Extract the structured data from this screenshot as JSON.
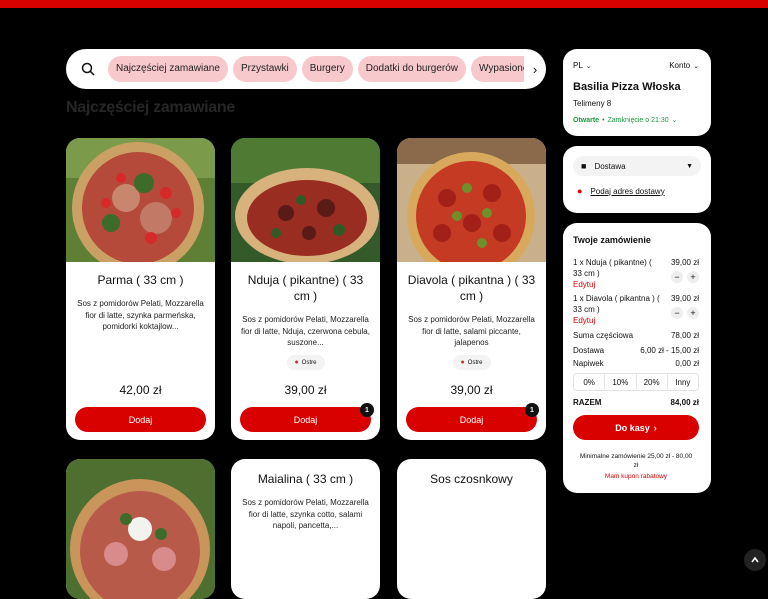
{
  "categories": {
    "items": [
      "Najczęściej zamawiane",
      "Przystawki",
      "Burgery",
      "Dodatki do burgerów",
      "Wypasione Frytki"
    ]
  },
  "section": {
    "title": "Najczęściej zamawiane"
  },
  "products": [
    {
      "name": "Parma ( 33 cm )",
      "desc": "Sos z pomidorów Pelati, Mozzarella fior di latte, szynka parmeńska, pomidorki koktajlow...",
      "price": "42,00 zł",
      "add": "Dodaj"
    },
    {
      "name": "Nduja ( pikantne) ( 33 cm )",
      "desc": "Sos z pomidorów Pelati, Mozzarella fior di latte, Nduja, czerwona cebula, suszone...",
      "badge": "Ostre",
      "price": "39,00 zł",
      "add": "Dodaj",
      "qty": "1"
    },
    {
      "name": "Diavola ( pikantna ) ( 33 cm )",
      "desc": "Sos z pomidorów Pelati, Mozzarella fior di latte, salami piccante, jalapenos",
      "badge": "Ostre",
      "price": "39,00 zł",
      "add": "Dodaj",
      "qty": "1"
    },
    {
      "name": "",
      "desc": ""
    },
    {
      "name": "Maialina ( 33 cm )",
      "desc": "Sos z pomidorów Pelati, Mozzarella fior di latte, szynka cotto, salami napoli, pancetta,..."
    },
    {
      "name": "Sos czosnkowy",
      "desc": ""
    }
  ],
  "restaurant": {
    "lang": "PL",
    "account": "Konto",
    "name": "Basilia Pizza Włoska",
    "address": "Telimeny 8",
    "open": "Otwarte",
    "close": "Zamknięcie o 21:30"
  },
  "delivery": {
    "mode": "Dostawa",
    "address_link": "Podaj adres dostawy"
  },
  "order": {
    "title": "Twoje zamówienie",
    "items": [
      {
        "name": "1 x Nduja ( pikantne) ( 33 cm )",
        "price": "39,00 zł",
        "edit": "Edytuj"
      },
      {
        "name": "1 x Diavola ( pikantna ) ( 33 cm )",
        "price": "39,00 zł",
        "edit": "Edytuj"
      }
    ],
    "subtotal_label": "Suma częściowa",
    "subtotal": "78,00 zł",
    "delivery_label": "Dostawa",
    "delivery": "6,00 zł - 15,00 zł",
    "tip_label": "Napiwek",
    "tip": "0,00 zł",
    "tips": [
      "0%",
      "10%",
      "20%",
      "Inny"
    ],
    "total_label": "RAZEM",
    "total": "84,00 zł",
    "checkout": "Do kasy",
    "minimum": "Minimalne zamówienie 25,00 zł - 80,00 zł",
    "coupon": "Mam kupon rabatowy"
  },
  "colors": {
    "accent": "#d90000",
    "chip": "#f7c9cc",
    "open": "#1a9a3a"
  }
}
